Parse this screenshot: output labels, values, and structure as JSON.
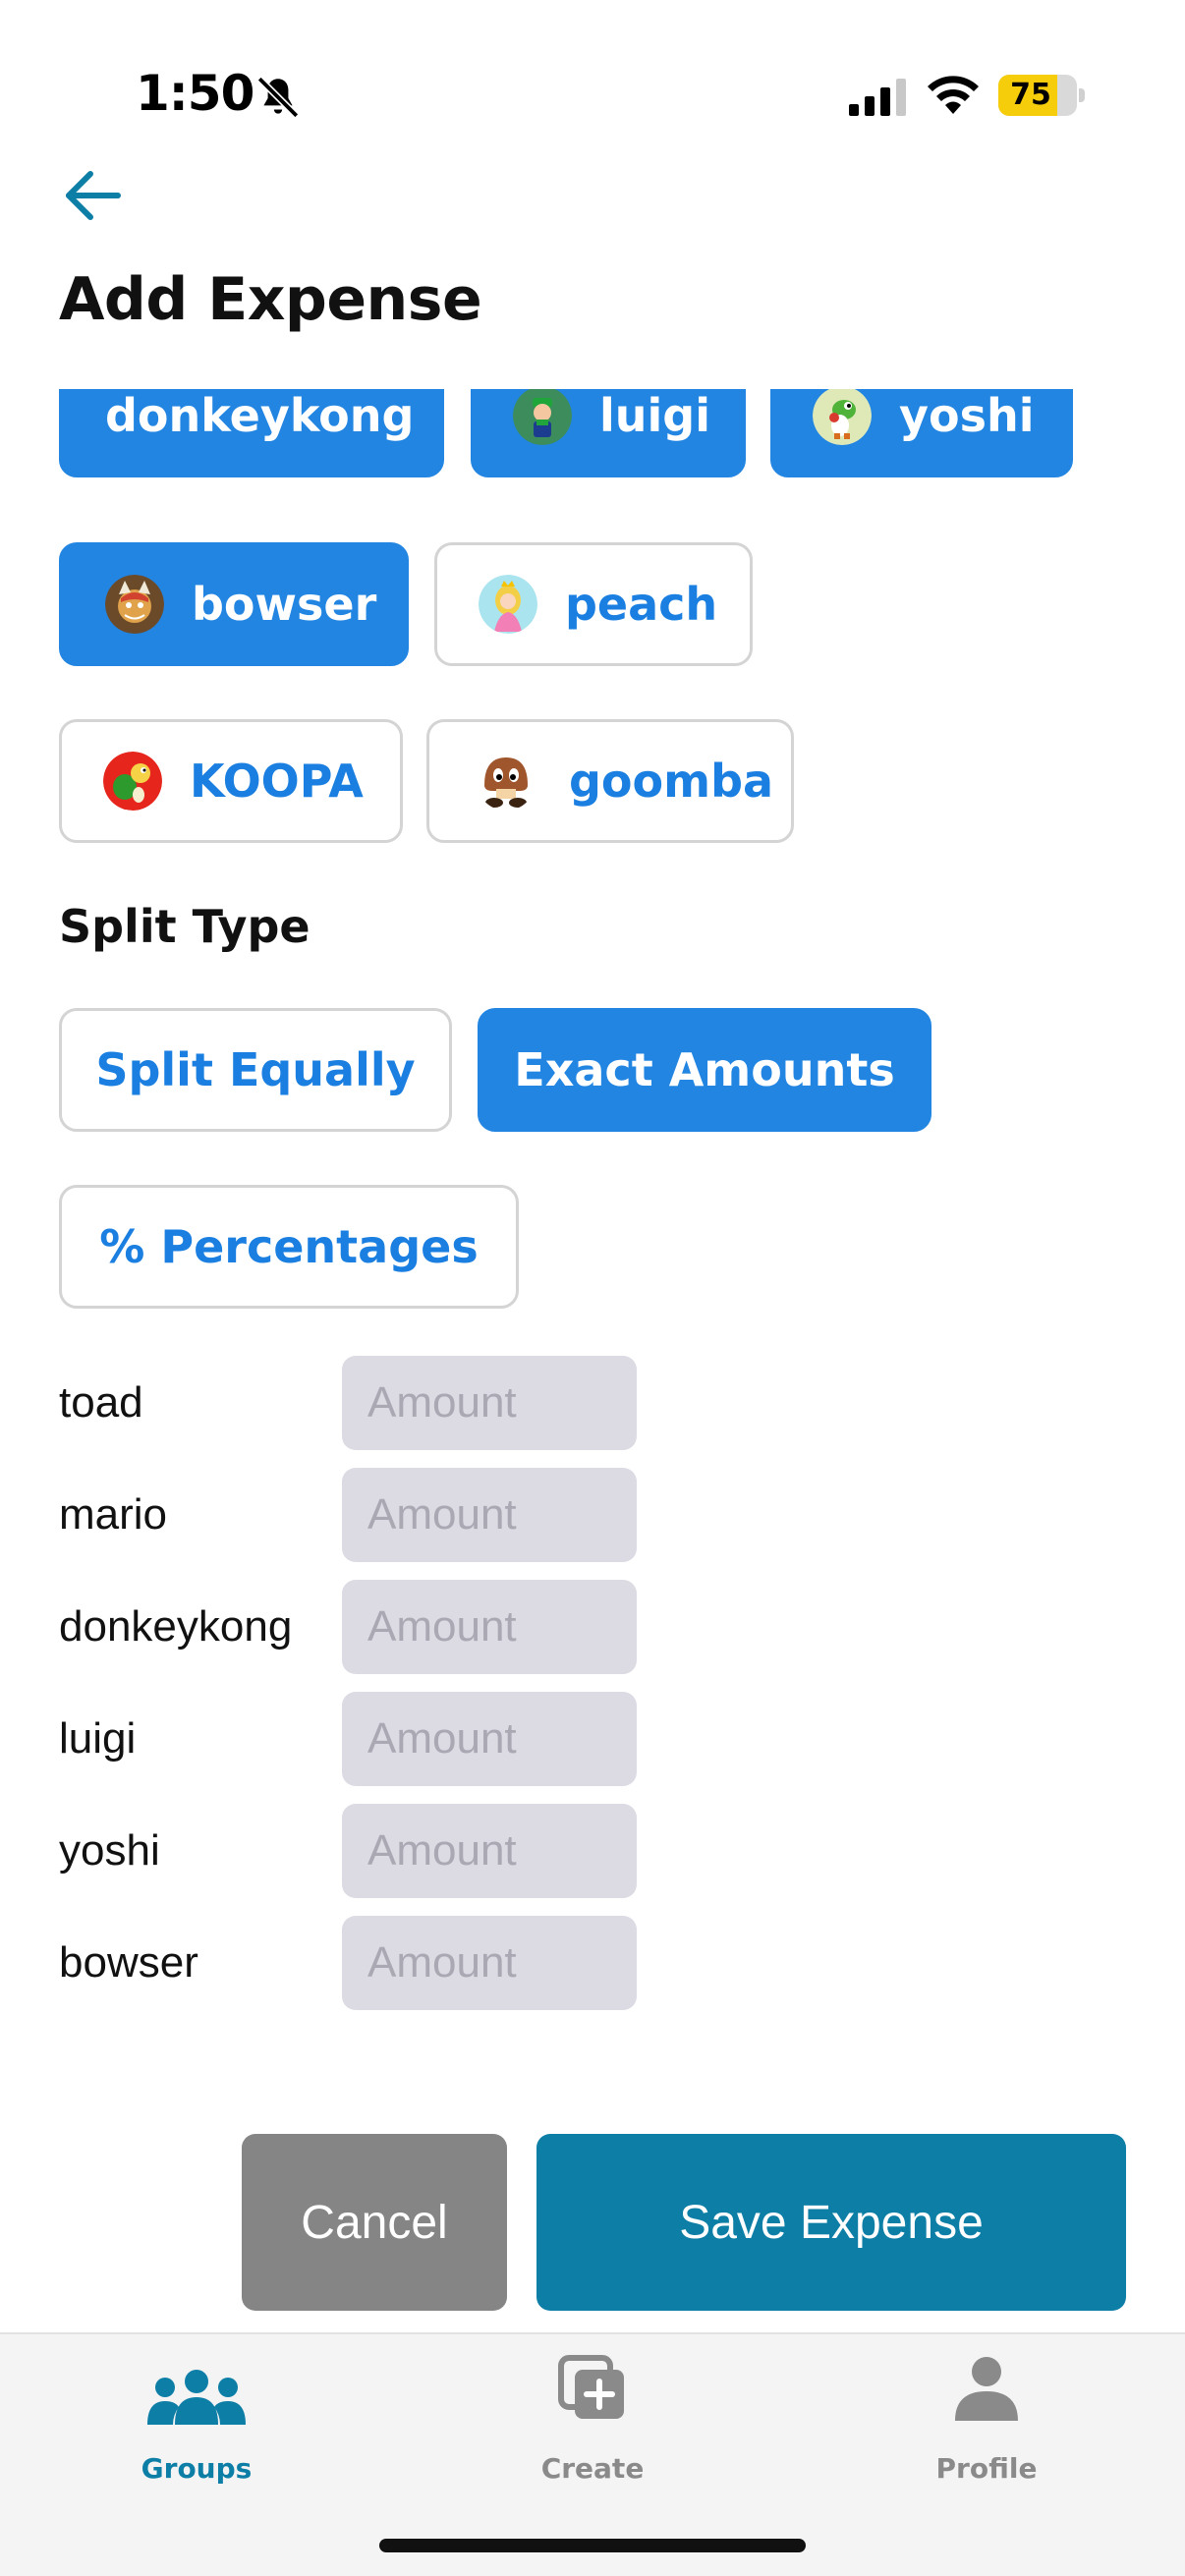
{
  "status_bar": {
    "time": "1:50",
    "battery": "75",
    "battery_level": 0.75
  },
  "header": {
    "title": "Add Expense"
  },
  "participants": [
    {
      "label": "donkeykong",
      "selected": true,
      "avatar": "none"
    },
    {
      "label": "luigi",
      "selected": true,
      "avatar": "luigi-avatar-icon"
    },
    {
      "label": "yoshi",
      "selected": true,
      "avatar": "yoshi-avatar-icon"
    },
    {
      "label": "bowser",
      "selected": true,
      "avatar": "bowser-avatar-icon"
    },
    {
      "label": "peach",
      "selected": false,
      "avatar": "peach-avatar-icon"
    },
    {
      "label": "KOOPA",
      "selected": false,
      "avatar": "koopa-avatar-icon"
    },
    {
      "label": "goomba",
      "selected": false,
      "avatar": "goomba-avatar-icon"
    }
  ],
  "split": {
    "title": "Split Type",
    "options": [
      {
        "label": "Split Equally",
        "selected": false
      },
      {
        "label": "Exact Amounts",
        "selected": true
      },
      {
        "label": "% Percentages",
        "selected": false
      }
    ]
  },
  "amounts": [
    {
      "name": "toad",
      "placeholder": "Amount"
    },
    {
      "name": "mario",
      "placeholder": "Amount"
    },
    {
      "name": "donkeykong",
      "placeholder": "Amount"
    },
    {
      "name": "luigi",
      "placeholder": "Amount"
    },
    {
      "name": "yoshi",
      "placeholder": "Amount"
    },
    {
      "name": "bowser",
      "placeholder": "Amount"
    }
  ],
  "actions": {
    "cancel": "Cancel",
    "save": "Save Expense"
  },
  "tabs": [
    {
      "label": "Groups",
      "icon": "groups-icon",
      "active": true
    },
    {
      "label": "Create",
      "icon": "create-icon",
      "active": false
    },
    {
      "label": "Profile",
      "icon": "profile-icon",
      "active": false
    }
  ],
  "colors": {
    "accent": "#2285e2",
    "primary": "#0d7ea6",
    "cancel": "#858585",
    "input_bg": "#dcdae3"
  }
}
